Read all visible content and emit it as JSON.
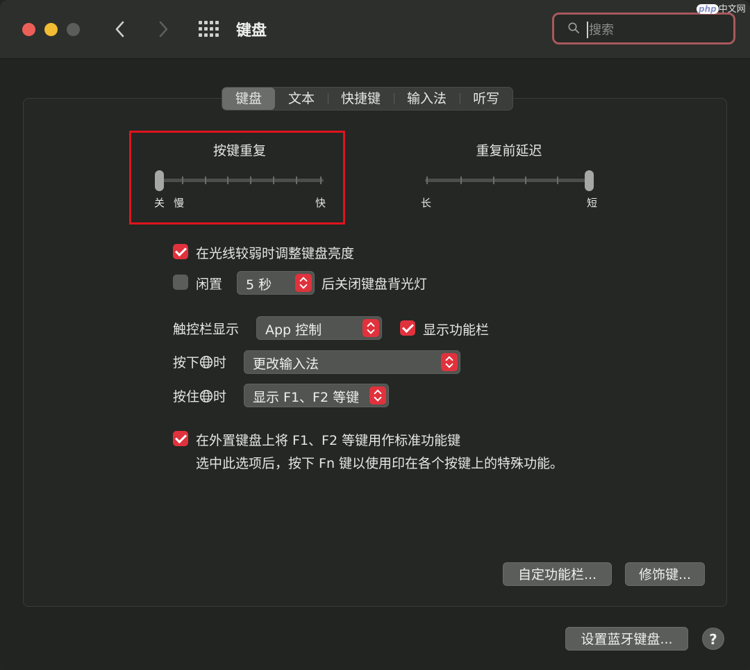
{
  "window": {
    "title": "键盘",
    "search": {
      "placeholder": "搜索",
      "value": ""
    }
  },
  "tabs": [
    {
      "label": "键盘",
      "active": true
    },
    {
      "label": "文本",
      "active": false
    },
    {
      "label": "快捷键",
      "active": false
    },
    {
      "label": "输入法",
      "active": false
    },
    {
      "label": "听写",
      "active": false
    }
  ],
  "key_repeat": {
    "title": "按键重复",
    "labels": {
      "off": "关",
      "slow": "慢",
      "fast": "快"
    },
    "position": 0
  },
  "delay_until_repeat": {
    "title": "重复前延迟",
    "labels": {
      "long": "长",
      "short": "短"
    },
    "position": 1
  },
  "options": {
    "adjust_brightness": {
      "label": "在光线较弱时调整键盘亮度",
      "checked": true
    },
    "backlight_off": {
      "label_prefix": "闲置",
      "popup_value": "5 秒",
      "label_suffix": "后关闭键盘背光灯",
      "checked": false
    }
  },
  "touch_bar": {
    "label": "触控栏显示",
    "popup_value": "App 控制",
    "show_fn_strip": {
      "label": "显示功能栏",
      "checked": true
    }
  },
  "globe_press": {
    "label_prefix": "按下",
    "label_suffix": "时",
    "popup_value": "更改输入法"
  },
  "globe_hold": {
    "label_prefix": "按住",
    "label_suffix": "时",
    "popup_value": "显示 F1、F2 等键"
  },
  "fn_keys": {
    "label": "在外置键盘上将 F1、F2 等键用作标准功能键",
    "description": "选中此选项后，按下 Fn 键以使用印在各个按键上的特殊功能。",
    "checked": true
  },
  "buttons": {
    "customize_touch_bar": "自定功能栏...",
    "modifier_keys": "修饰键...",
    "setup_bluetooth": "设置蓝牙键盘...",
    "help": "?"
  },
  "watermark": {
    "logo": "php",
    "text": "中文网"
  },
  "colors": {
    "accent": "#e0323d",
    "highlight_box": "#e0141d",
    "search_focus": "#a9585d"
  }
}
